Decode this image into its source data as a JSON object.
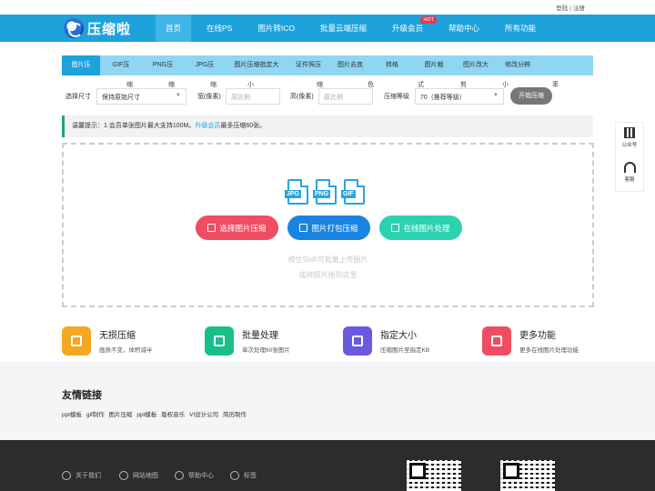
{
  "top_links": {
    "login": "登陆",
    "sep": "|",
    "register": "注册"
  },
  "logo": {
    "text": "压缩啦"
  },
  "nav": {
    "items": [
      {
        "label": "首页",
        "active": true
      },
      {
        "label": "在线PS"
      },
      {
        "label": "图片转ICO"
      },
      {
        "label": "批量云端压缩"
      },
      {
        "label": "升级会员",
        "badge": "HOT"
      },
      {
        "label": "帮助中心"
      },
      {
        "label": "所有功能"
      }
    ]
  },
  "tabs": {
    "items": [
      "图片压",
      "GIF压",
      "PNG压",
      "JPG压",
      "图片压缩指定大",
      "证件照压",
      "图片去底",
      "转格",
      "图片裁",
      "图片改大",
      "修改分辨"
    ],
    "sub": [
      "缩",
      "缩",
      "缩",
      "小",
      "缩",
      "色",
      "式",
      "剪",
      "小",
      "率"
    ]
  },
  "form": {
    "size_label": "选择尺寸",
    "size_value": "保持原始尺寸",
    "width_label": "宽(像素)",
    "width_placeholder": "原比例",
    "height_label": "高(像素)",
    "height_placeholder": "原比例",
    "level_label": "压缩等级",
    "level_value": "70（推荐等级）",
    "start_button": "开始压缩"
  },
  "tip": {
    "prefix": "温馨提示：1.会员单张图片最大支持100M。",
    "link": "升级会员",
    "suffix": "最多压缩60张。"
  },
  "upload": {
    "formats": [
      "JPG",
      "PNG",
      "GIF"
    ],
    "buttons": [
      "选择图片压缩",
      "图片打包压缩",
      "在线图片处理"
    ],
    "hint1": "按住Shift可批量上传图片",
    "hint2": "或将照片拖到这里"
  },
  "side": {
    "wechat": "公众号",
    "service": "客服"
  },
  "features": [
    {
      "title": "无损压缩",
      "desc": "画质不变，体积减半",
      "color": "#f5a623"
    },
    {
      "title": "批量处理",
      "desc": "单次处理60张图片",
      "color": "#17c08a"
    },
    {
      "title": "指定大小",
      "desc": "压缩图片至指定KB",
      "color": "#6a5ae0"
    },
    {
      "title": "更多功能",
      "desc": "更多在线图片处理功能",
      "color": "#ef4d63"
    }
  ],
  "friends": {
    "title": "友情链接",
    "links": [
      "ppt模板",
      "gif制作",
      "图片压缩",
      "ppt模板",
      "版权音乐",
      "VI设计公司",
      "简历制作"
    ]
  },
  "footer": {
    "links": [
      "关于我们",
      "网站地图",
      "帮助中心",
      "标签"
    ]
  },
  "colors": {
    "primary": "#1ea2dc",
    "tabs_bg": "#8fd6f2",
    "footer_bg": "#2b2c2e"
  }
}
